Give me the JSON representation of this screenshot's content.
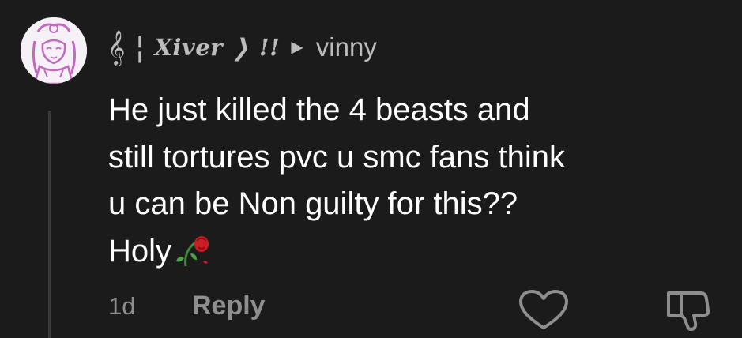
{
  "comment": {
    "username_prefix": "𝄞 ¦",
    "username": "Xiver ❭ !!",
    "reply_arrow": "▶",
    "recipient": "vinny",
    "lines": [
      "He just killed the 4 beasts and",
      "still tortures pvc u smc fans think",
      "u can be Non guilty for this??",
      "Holy"
    ],
    "emoji": "wilted-rose-icon",
    "time": "1d",
    "reply_label": "Reply"
  },
  "icons": {
    "heart": "heart-outline-icon",
    "dislike": "thumbs-down-outline-icon"
  },
  "colors": {
    "background": "#1b1b1b",
    "text": "#ffffff",
    "muted": "#8e8e8e",
    "header_text": "#bcbcbc",
    "thread_line": "#3a3a3a",
    "avatar_bg": "#f6f0f7",
    "avatar_ink": "#c06bbf"
  }
}
